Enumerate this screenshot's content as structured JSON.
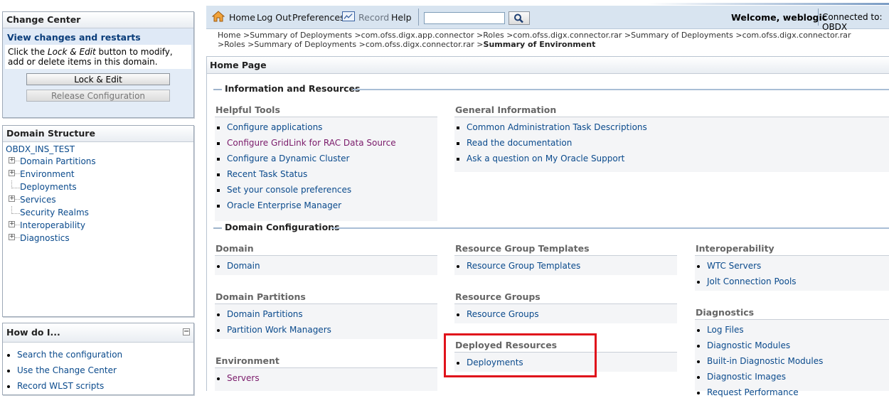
{
  "change_center": {
    "title": "Change Center",
    "subtitle": "View changes and restarts",
    "desc_part1": "Click the ",
    "desc_em": "Lock & Edit",
    "desc_part2": " button to modify, add or delete items in this domain.",
    "lock_button": "Lock & Edit",
    "release_button": "Release Configuration"
  },
  "domain_structure": {
    "title": "Domain Structure",
    "root": "OBDX_INS_TEST",
    "nodes": [
      "Domain Partitions",
      "Environment",
      "Deployments",
      "Services",
      "Security Realms",
      "Interoperability",
      "Diagnostics"
    ]
  },
  "how_do_i": {
    "title": "How do I...",
    "collapse_glyph": "⊟",
    "items": [
      "Search the configuration",
      "Use the Change Center",
      "Record WLST scripts"
    ]
  },
  "toolbar": {
    "home": "Home",
    "logout": "Log Out",
    "preferences": "Preferences",
    "record": "Record",
    "help": "Help",
    "search_value": "",
    "welcome": "Welcome, weblogic",
    "connected": "Connected to: OBDX"
  },
  "breadcrumb": {
    "trail": "Home >Summary of Deployments >com.ofss.digx.app.connector >Roles >com.ofss.digx.connector.rar >Summary of Deployments >com.ofss.digx.connector.rar >Roles >Summary of Deployments >com.ofss.digx.connector.rar >",
    "current": "Summary of Environment"
  },
  "main": {
    "page_title": "Home Page",
    "section1": "Information and Resources",
    "section2": "Domain Configurations",
    "helpful_tools": {
      "title": "Helpful Tools",
      "items": [
        "Configure applications",
        "Configure GridLink for RAC Data Source",
        "Configure a Dynamic Cluster",
        "Recent Task Status",
        "Set your console preferences",
        "Oracle Enterprise Manager"
      ]
    },
    "general_info": {
      "title": "General Information",
      "items": [
        "Common Administration Task Descriptions",
        "Read the documentation",
        "Ask a question on My Oracle Support"
      ]
    },
    "domain": {
      "title": "Domain",
      "items": [
        "Domain"
      ]
    },
    "domain_partitions": {
      "title": "Domain Partitions",
      "items": [
        "Domain Partitions",
        "Partition Work Managers"
      ]
    },
    "environment": {
      "title": "Environment",
      "items": [
        "Servers"
      ]
    },
    "rg_templates": {
      "title": "Resource Group Templates",
      "items": [
        "Resource Group Templates"
      ]
    },
    "resource_groups": {
      "title": "Resource Groups",
      "items": [
        "Resource Groups"
      ]
    },
    "deployed_resources": {
      "title": "Deployed Resources",
      "items": [
        "Deployments"
      ]
    },
    "interoperability": {
      "title": "Interoperability",
      "items": [
        "WTC Servers",
        "Jolt Connection Pools"
      ]
    },
    "diagnostics": {
      "title": "Diagnostics",
      "items": [
        "Log Files",
        "Diagnostic Modules",
        "Built-in Diagnostic Modules",
        "Diagnostic Images",
        "Request Performance"
      ]
    }
  },
  "colors": {
    "accent_link": "#0a4a8c",
    "visited_link": "#7a1a6a",
    "highlight": "#e0121b",
    "toolbar_bg": "#d8e4f0"
  }
}
